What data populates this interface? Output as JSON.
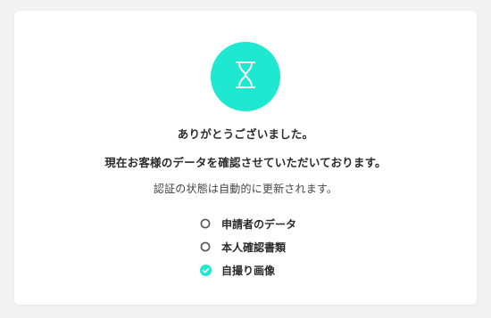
{
  "colors": {
    "accent": "#1ee8d0",
    "pending": "#555555",
    "background": "#f2f2f2",
    "card": "#ffffff"
  },
  "hero": {
    "icon": "hourglass-icon"
  },
  "messages": {
    "thanks": "ありがとうございました。",
    "confirming": "現在お客様のデータを確認させていただいております。",
    "auto_update": "認証の状態は自動的に更新されます。"
  },
  "status": [
    {
      "label": "申請者のデータ",
      "state": "pending",
      "icon": "circle-outline-icon"
    },
    {
      "label": "本人確認書類",
      "state": "pending",
      "icon": "circle-outline-icon"
    },
    {
      "label": "自撮り画像",
      "state": "complete",
      "icon": "check-circle-icon"
    }
  ]
}
